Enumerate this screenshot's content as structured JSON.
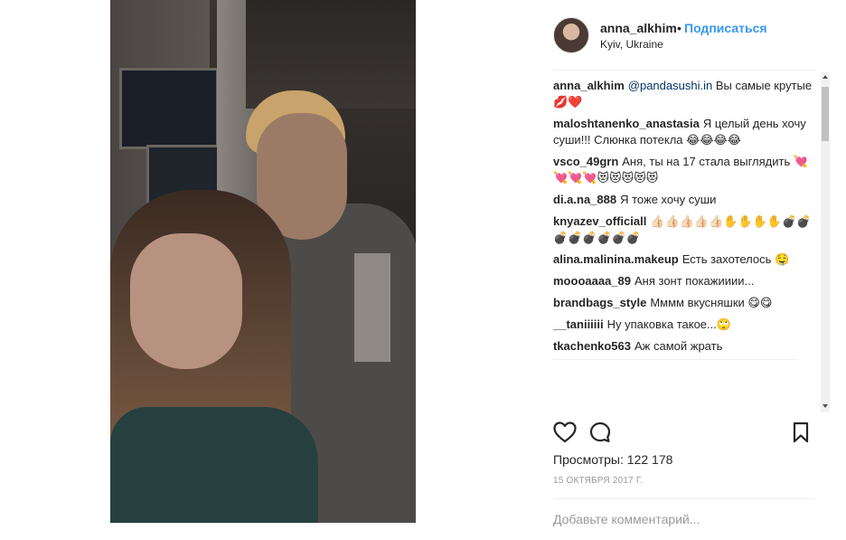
{
  "post": {
    "username": "anna_alkhim",
    "separator": "•",
    "follow_label": "Подписаться",
    "location": "Kyiv, Ukraine"
  },
  "comments": [
    {
      "user": "anna_alkhim",
      "mention": "@pandasushi.in",
      "text": " Вы самые крутые💋❤️"
    },
    {
      "user": "maloshtanenko_anastasia",
      "mention": "",
      "text": "Я целый день хочу суши!!! Слюнка потекла 😂😂😂😂"
    },
    {
      "user": "vsco_49grn",
      "mention": "",
      "text": "Аня, ты на 17 стала выглядить 💘💘💘💘😻😻😻😻😻"
    },
    {
      "user": "di.a.na_888",
      "mention": "",
      "text": "Я тоже хочу суши"
    },
    {
      "user": "knyazev_officiall",
      "mention": "",
      "text": "👍🏻👍🏻👍🏻👍🏻👍🏻✋✋✋✋💣💣💣💣💣💣💣💣"
    },
    {
      "user": "alina.malinina.makeup",
      "mention": "",
      "text": "Есть захотелось 🤤"
    },
    {
      "user": "moooaaaa_89",
      "mention": "",
      "text": "Аня зонт покажииии..."
    },
    {
      "user": "brandbags_style",
      "mention": "",
      "text": "Мммм вкусняшки 😋😋"
    },
    {
      "user": "__taniiiiii",
      "mention": "",
      "text": "Ну упаковка такое...🙄"
    },
    {
      "user": "tkachenko563",
      "mention": "",
      "text": "Аж самой жрать"
    }
  ],
  "actions": {
    "like_icon": "heart-icon",
    "comment_icon": "speech-bubble-icon",
    "save_icon": "bookmark-icon"
  },
  "stats": {
    "views_label": "Просмотры:",
    "views_value": "122 178",
    "date": "15 ОКТЯБРЯ 2017 Г."
  },
  "comment_box": {
    "placeholder": "Добавьте комментарий..."
  },
  "colors": {
    "accent": "#3897f0",
    "text": "#262626",
    "muted": "#999999",
    "mention": "#003569"
  }
}
